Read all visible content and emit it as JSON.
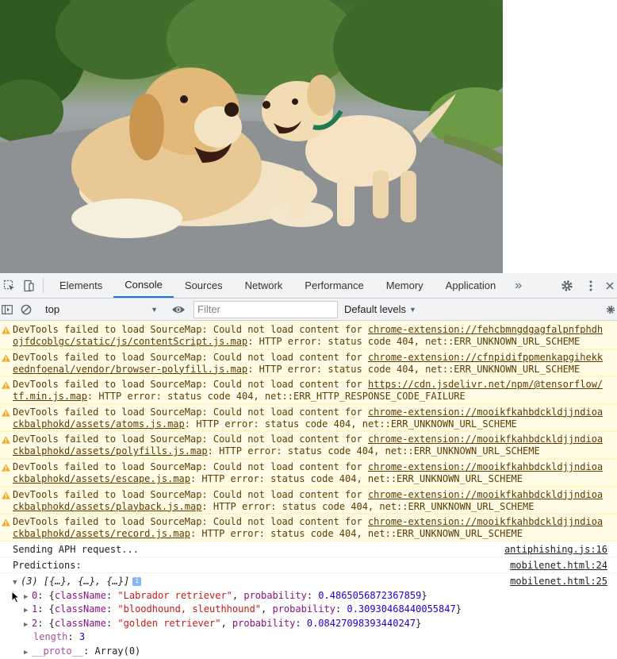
{
  "devtools": {
    "tabs": [
      "Elements",
      "Console",
      "Sources",
      "Network",
      "Performance",
      "Memory",
      "Application"
    ],
    "active_tab": "Console",
    "more_tabs_glyph": "»"
  },
  "toolbar": {
    "context": "top",
    "filter_placeholder": "Filter",
    "levels_label": "Default levels"
  },
  "warnings": [
    {
      "prefix": "DevTools failed to load SourceMap: Could not load content for ",
      "url_a": "chrome-extension://fehcbmngdgagfalpnfphdh",
      "url_b": "ojfdcoblgc/static/js/contentScript.js.map",
      "suffix": ": HTTP error: status code 404, net::ERR_UNKNOWN_URL_SCHEME"
    },
    {
      "prefix": "DevTools failed to load SourceMap: Could not load content for ",
      "url_a": "chrome-extension://cfnpidifppmenkapgihekk",
      "url_b": "eednfoenal/vendor/browser-polyfill.js.map",
      "suffix": ": HTTP error: status code 404, net::ERR_UNKNOWN_URL_SCHEME"
    },
    {
      "prefix": "DevTools failed to load SourceMap: Could not load content for ",
      "url_a": "https://cdn.jsdelivr.net/npm/@tensorflow/",
      "url_b": "tf.min.js.map",
      "suffix": ": HTTP error: status code 404, net::ERR_HTTP_RESPONSE_CODE_FAILURE"
    },
    {
      "prefix": "DevTools failed to load SourceMap: Could not load content for ",
      "url_a": "chrome-extension://mooikfkahbdckldjjndioa",
      "url_b": "ckbalphokd/assets/atoms.js.map",
      "suffix": ": HTTP error: status code 404, net::ERR_UNKNOWN_URL_SCHEME"
    },
    {
      "prefix": "DevTools failed to load SourceMap: Could not load content for ",
      "url_a": "chrome-extension://mooikfkahbdckldjjndioa",
      "url_b": "ckbalphokd/assets/polyfills.js.map",
      "suffix": ": HTTP error: status code 404, net::ERR_UNKNOWN_URL_SCHEME"
    },
    {
      "prefix": "DevTools failed to load SourceMap: Could not load content for ",
      "url_a": "chrome-extension://mooikfkahbdckldjjndioa",
      "url_b": "ckbalphokd/assets/escape.js.map",
      "suffix": ": HTTP error: status code 404, net::ERR_UNKNOWN_URL_SCHEME"
    },
    {
      "prefix": "DevTools failed to load SourceMap: Could not load content for ",
      "url_a": "chrome-extension://mooikfkahbdckldjjndioa",
      "url_b": "ckbalphokd/assets/playback.js.map",
      "suffix": ": HTTP error: status code 404, net::ERR_UNKNOWN_URL_SCHEME"
    },
    {
      "prefix": "DevTools failed to load SourceMap: Could not load content for ",
      "url_a": "chrome-extension://mooikfkahbdckldjjndioa",
      "url_b": "ckbalphokd/assets/record.js.map",
      "suffix": ": HTTP error: status code 404, net::ERR_UNKNOWN_URL_SCHEME"
    }
  ],
  "logs": {
    "aph": {
      "text": "Sending APH request...",
      "source": "antiphishing.js:16"
    },
    "predictions": {
      "text": "Predictions:",
      "source": "mobilenet.html:24"
    },
    "array": {
      "summary": "(3) [{…}, {…}, {…}]",
      "source": "mobilenet.html:25",
      "items": [
        {
          "index": "0",
          "className": "\"Labrador retriever\"",
          "probability": "0.4865056872367859"
        },
        {
          "index": "1",
          "className": "\"bloodhound, sleuthhound\"",
          "probability": "0.30930468440055847"
        },
        {
          "index": "2",
          "className": "\"golden retriever\"",
          "probability": "0.08427098393440247"
        }
      ],
      "length_key": "length",
      "length_value": "3",
      "proto_key": "__proto__",
      "proto_value": "Array(0)"
    }
  },
  "colors": {
    "warning_bg": "#fffbe5",
    "warning_text": "#5c3c00",
    "string": "#c41a16",
    "number": "#1c00cf",
    "key": "#881280",
    "active_tab": "#1a73e8"
  }
}
